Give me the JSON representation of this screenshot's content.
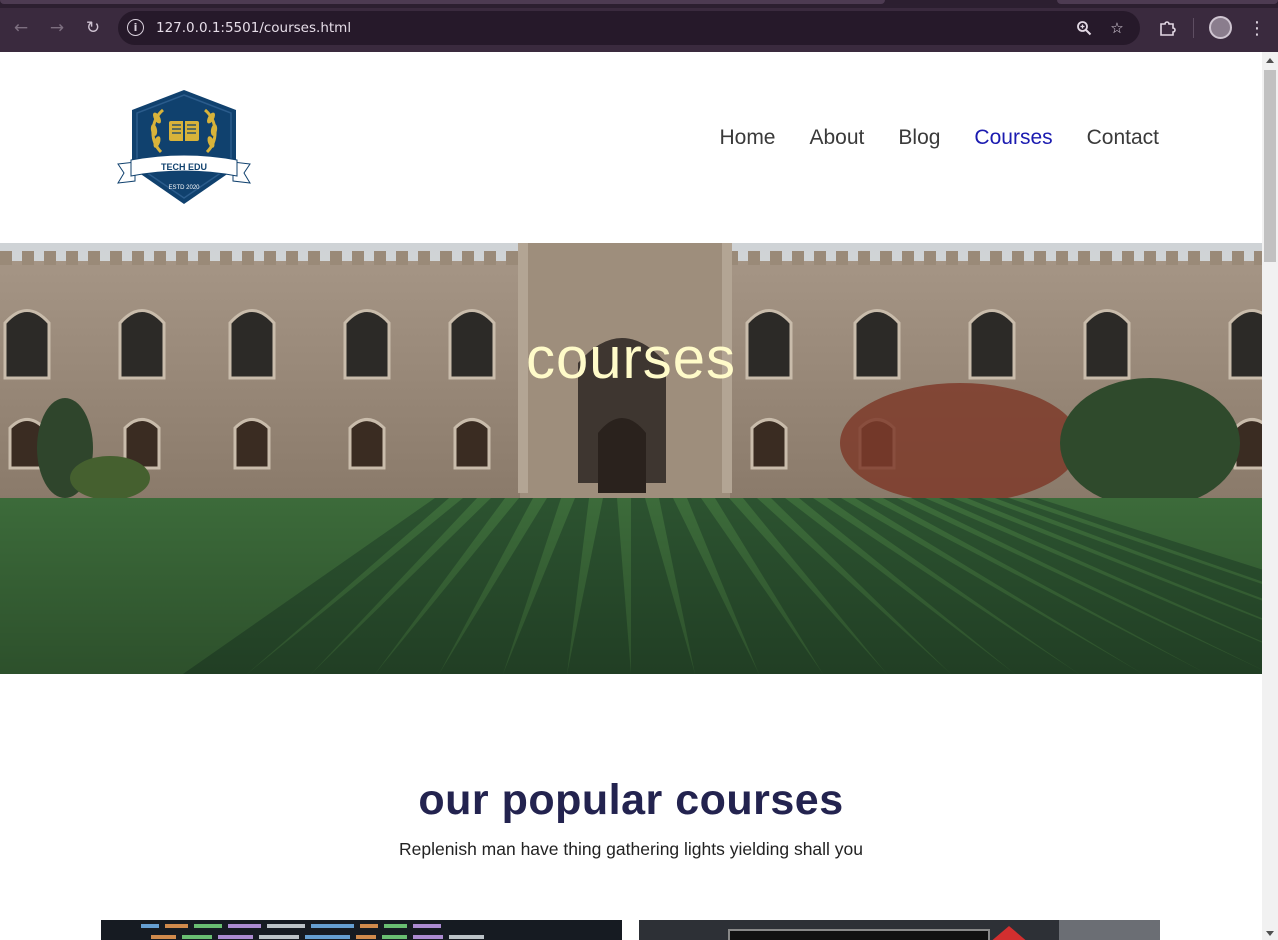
{
  "browser": {
    "url": "127.0.0.1:5501/courses.html",
    "icons": {
      "back": "back-arrow-icon",
      "forward": "forward-arrow-icon",
      "reload": "reload-icon",
      "site_info": "site-info-icon",
      "zoom": "zoom-icon",
      "bookmark": "star-icon",
      "extensions": "puzzle-icon",
      "profile": "profile-avatar",
      "menu": "more-vert-icon"
    }
  },
  "header": {
    "logo": {
      "name": "TECH EDU",
      "tagline": "ESTD 2020"
    },
    "nav": [
      {
        "label": "Home",
        "active": false
      },
      {
        "label": "About",
        "active": false
      },
      {
        "label": "Blog",
        "active": false
      },
      {
        "label": "Courses",
        "active": true
      },
      {
        "label": "Contact",
        "active": false
      }
    ]
  },
  "hero": {
    "title": "courses"
  },
  "popular": {
    "title": "our popular courses",
    "subtitle": "Replenish man have thing gathering lights yielding shall you"
  },
  "colors": {
    "nav_active": "#1b1bb0",
    "hero_title": "#fffbc9",
    "section_title": "#23234f",
    "logo_navy": "#10416e",
    "logo_gold": "#d8b33a"
  }
}
